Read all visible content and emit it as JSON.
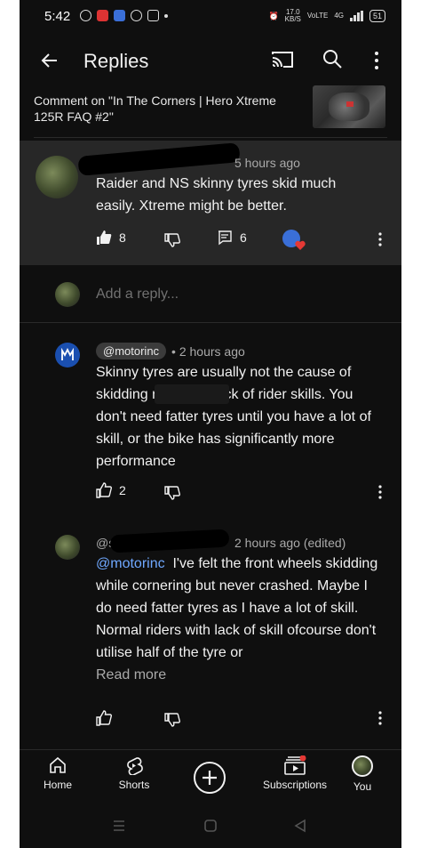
{
  "status_bar": {
    "time": "5:42",
    "network_speed": "17.0\nKB/S",
    "network_type": "VoLTE",
    "signal": "4G",
    "battery": "51"
  },
  "app_bar": {
    "title": "Replies"
  },
  "context": {
    "comment_on": "Comment on \"In The Corners | Hero Xtreme 125R FAQ #2\""
  },
  "main_comment": {
    "time": "5 hours ago",
    "text": "Raider and NS skinny tyres skid much easily. Xtreme might be better.",
    "likes": "8",
    "replies": "6"
  },
  "reply_box": {
    "placeholder": "Add a reply..."
  },
  "replies": [
    {
      "handle": "@motorinc",
      "time": "• 2 hours ago",
      "text": "Skinny tyres are usually not the cause of skidding n. It's the lack of rider skills. You don't need fatter tyres until you have a lot of skill, or the bike has significantly more performance",
      "likes": "2"
    },
    {
      "handle_prefix": "@s",
      "time": "2 hours ago (edited)",
      "mention": "@motorinc",
      "text": "I've felt the front wheels skidding while cornering but never crashed. Maybe I do need fatter tyres as I have a lot of skill. Normal riders with lack of skill ofcourse don't utilise half of the tyre or",
      "read_more": "Read more"
    }
  ],
  "bottom_nav": [
    {
      "label": "Home"
    },
    {
      "label": "Shorts"
    },
    {
      "label": ""
    },
    {
      "label": "Subscriptions"
    },
    {
      "label": "You"
    }
  ],
  "colors": {
    "background": "#0f0f0f",
    "highlight": "#272727",
    "mention": "#6fa8ff",
    "accent_red": "#e53935"
  }
}
